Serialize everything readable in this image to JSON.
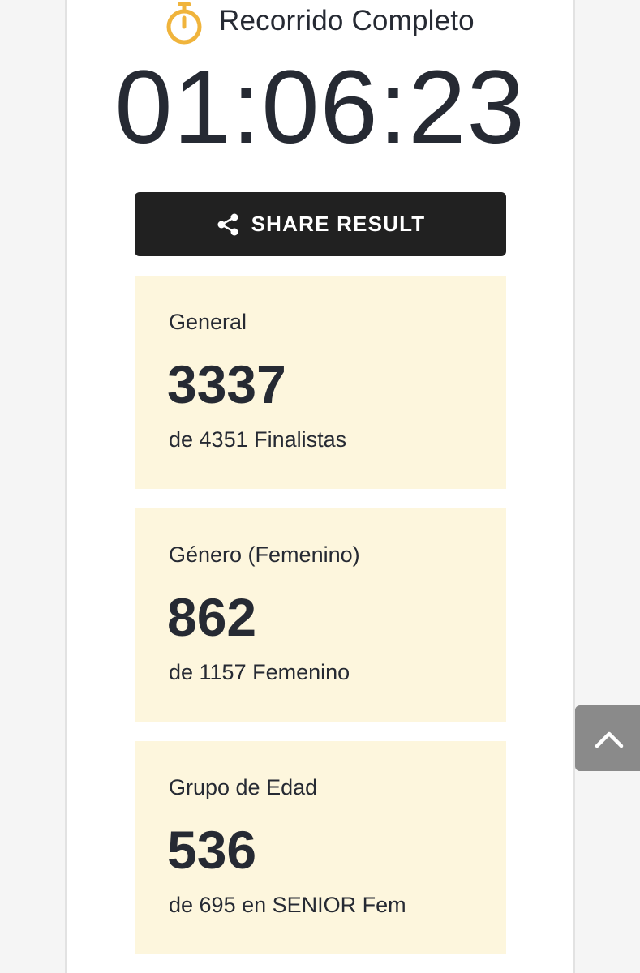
{
  "status": {
    "icon": "stopwatch-icon",
    "label": "Recorrido Completo",
    "icon_color": "#F0B43C"
  },
  "finish_time": "01:06:23",
  "share_button": {
    "icon": "share-icon",
    "label": "SHARE RESULT"
  },
  "rankings": [
    {
      "label": "General",
      "rank": "3337",
      "total_text": "de 4351 Finalistas"
    },
    {
      "label": "Género (Femenino)",
      "rank": "862",
      "total_text": "de 1157 Femenino"
    },
    {
      "label": "Grupo de Edad",
      "rank": "536",
      "total_text": "de 695 en SENIOR Fem"
    }
  ],
  "scroll_top_button": {
    "icon": "chevron-up-icon"
  },
  "colors": {
    "card_background": "#FDF6DD",
    "button_background": "#212121",
    "text": "#262A33",
    "scroll_button": "#8A8A8A"
  }
}
